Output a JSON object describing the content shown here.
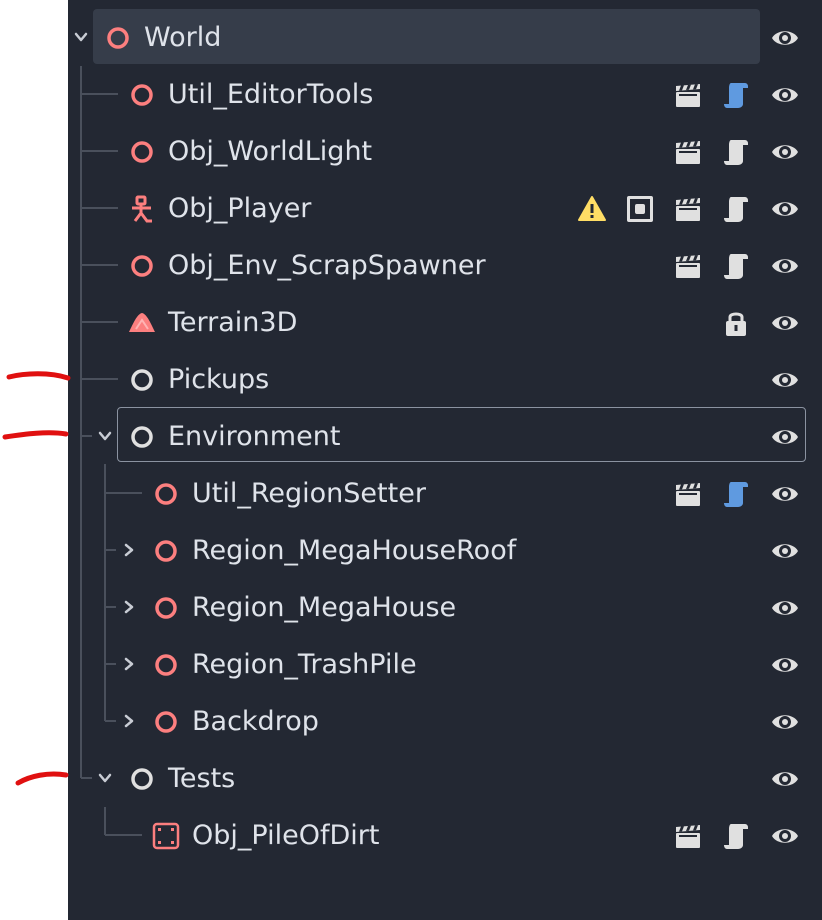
{
  "scene_tree": {
    "nodes": [
      {
        "id": "world",
        "name": "World",
        "depth": 0,
        "expanded": true,
        "selected": true,
        "icon": "node3d-circle-icon",
        "actions": []
      },
      {
        "id": "util-editortools",
        "name": "Util_EditorTools",
        "depth": 1,
        "icon": "node3d-circle-icon",
        "actions": [
          "clapperboard-icon",
          "script-blue-icon"
        ]
      },
      {
        "id": "obj-worldlight",
        "name": "Obj_WorldLight",
        "depth": 1,
        "icon": "node3d-circle-icon",
        "actions": [
          "clapperboard-icon",
          "script-gray-icon"
        ]
      },
      {
        "id": "obj-player",
        "name": "Obj_Player",
        "depth": 1,
        "icon": "character-body-icon",
        "actions": [
          "warning-icon",
          "signal-square-icon",
          "clapperboard-icon",
          "script-gray-icon"
        ]
      },
      {
        "id": "obj-env-scrapspawner",
        "name": "Obj_Env_ScrapSpawner",
        "depth": 1,
        "icon": "node3d-circle-icon",
        "actions": [
          "clapperboard-icon",
          "script-gray-icon"
        ]
      },
      {
        "id": "terrain3d",
        "name": "Terrain3D",
        "depth": 1,
        "icon": "terrain-icon",
        "actions": [
          "lock-icon"
        ]
      },
      {
        "id": "pickups",
        "name": "Pickups",
        "depth": 1,
        "icon": "node-circle-icon",
        "actions": []
      },
      {
        "id": "environment",
        "name": "Environment",
        "depth": 1,
        "expanded": true,
        "focused": true,
        "icon": "node-circle-icon",
        "actions": []
      },
      {
        "id": "util-regionsetter",
        "name": "Util_RegionSetter",
        "depth": 2,
        "icon": "node3d-circle-icon",
        "actions": [
          "clapperboard-icon",
          "script-blue-icon"
        ]
      },
      {
        "id": "region-megahouseroof",
        "name": "Region_MegaHouseRoof",
        "depth": 2,
        "collapsed": true,
        "icon": "node3d-circle-icon",
        "actions": []
      },
      {
        "id": "region-megahouse",
        "name": "Region_MegaHouse",
        "depth": 2,
        "collapsed": true,
        "icon": "node3d-circle-icon",
        "actions": []
      },
      {
        "id": "region-trashpile",
        "name": "Region_TrashPile",
        "depth": 2,
        "collapsed": true,
        "icon": "node3d-circle-icon",
        "actions": []
      },
      {
        "id": "backdrop",
        "name": "Backdrop",
        "depth": 2,
        "collapsed": true,
        "icon": "node3d-circle-icon",
        "actions": []
      },
      {
        "id": "tests",
        "name": "Tests",
        "depth": 1,
        "expanded": true,
        "icon": "node-circle-icon",
        "actions": []
      },
      {
        "id": "obj-pileofdirt",
        "name": "Obj_PileOfDirt",
        "depth": 2,
        "icon": "bounding-box-icon",
        "actions": [
          "clapperboard-icon",
          "script-gray-icon"
        ]
      }
    ],
    "visibility_icon": "eye-icon"
  },
  "colors": {
    "panel_bg": "#232833",
    "selected_bg": "#363d4a",
    "text": "#dfe3ea",
    "node3d": "#fc7f7f",
    "node": "#e0e0e0",
    "script_blue": "#5f9ae0",
    "warning": "#ffdd65",
    "annotation": "#e01010"
  }
}
